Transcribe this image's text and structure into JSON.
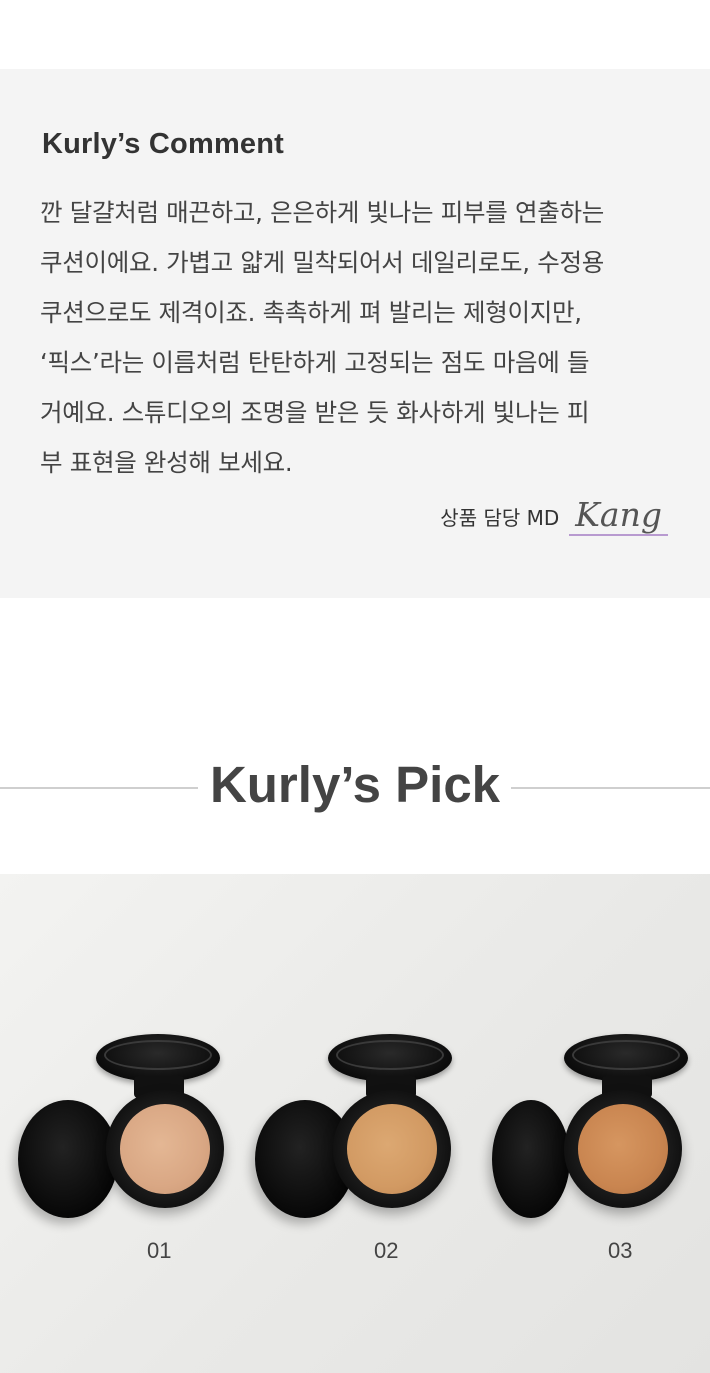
{
  "comment": {
    "title": "Kurly’s Comment",
    "lines": [
      "깐 달걀처럼 매끈하고, 은은하게 빛나는 피부를 연출하는",
      "쿠션이에요. 가볍고 얇게 밀착되어서 데일리로도, 수정용",
      "쿠션으로도 제격이죠. 촉촉하게 펴 발리는 제형이지만,",
      "‘픽스’라는 이름처럼 탄탄하게 고정되는 점도 마음에 들",
      "거예요. 스튜디오의 조명을 받은 듯 화사하게 빛나는 피",
      "부 표현을 완성해 보세요."
    ],
    "signature_label": "상품 담당 MD",
    "signature_name": "Kang"
  },
  "pick": {
    "title": "Kurly’s Pick"
  },
  "products": [
    {
      "label": "01",
      "cushion_color": "#d9a784"
    },
    {
      "label": "02",
      "cushion_color": "#d29a63"
    },
    {
      "label": "03",
      "cushion_color": "#c98550"
    }
  ]
}
